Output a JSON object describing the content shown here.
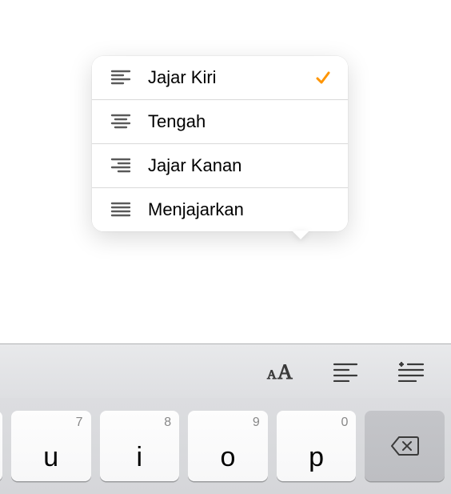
{
  "popover": {
    "items": [
      {
        "label": "Jajar Kiri",
        "icon": "align-left-icon",
        "selected": true
      },
      {
        "label": "Tengah",
        "icon": "align-center-icon",
        "selected": false
      },
      {
        "label": "Jajar Kanan",
        "icon": "align-right-icon",
        "selected": false
      },
      {
        "label": "Menjajarkan",
        "icon": "align-justify-icon",
        "selected": false
      }
    ]
  },
  "toolbar": {
    "text_size_btn": "aA",
    "align_btn": "align",
    "list_btn": "list"
  },
  "keyboard": {
    "keys": [
      {
        "main": "u",
        "alt": "7"
      },
      {
        "main": "i",
        "alt": "8"
      },
      {
        "main": "o",
        "alt": "9"
      },
      {
        "main": "p",
        "alt": "0"
      }
    ],
    "delete_key": "delete"
  },
  "colors": {
    "accent": "#ff9500"
  }
}
